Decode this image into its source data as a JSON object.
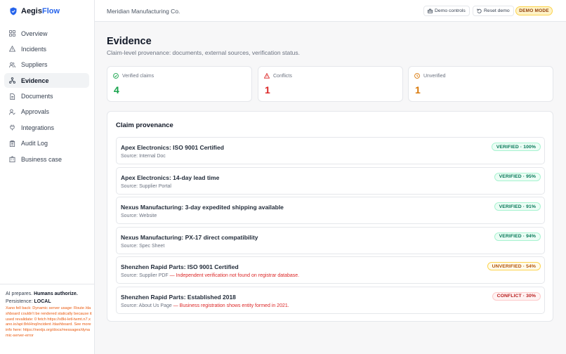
{
  "brand": {
    "name_part1": "Aegis",
    "name_part2": "Flow",
    "accent": "#2563eb"
  },
  "sidebar": {
    "items": [
      {
        "label": "Overview",
        "icon": "grid-icon",
        "active": false
      },
      {
        "label": "Incidents",
        "icon": "warning-triangle-icon",
        "active": false
      },
      {
        "label": "Suppliers",
        "icon": "users-icon",
        "active": false
      },
      {
        "label": "Evidence",
        "icon": "network-icon",
        "active": true
      },
      {
        "label": "Documents",
        "icon": "document-icon",
        "active": false
      },
      {
        "label": "Approvals",
        "icon": "user-check-icon",
        "active": false
      },
      {
        "label": "Integrations",
        "icon": "plug-icon",
        "active": false
      },
      {
        "label": "Audit Log",
        "icon": "clipboard-icon",
        "active": false
      },
      {
        "label": "Business case",
        "icon": "building-icon",
        "active": false
      }
    ],
    "footer": {
      "tagline_prefix": "AI prepares.",
      "tagline_bold": "Humans authorize.",
      "persistence_label": "Persistence:",
      "persistence_value": "LOCAL",
      "error_text": "Xano fell back: Dynamic server usage: Route /dashboard couldn't be rendered statically because it used revalidate: 0 fetch https://x8ki-letl-twmt.n7.xano.io/api:8rkHnq/incident /dashboard. See more info here: https://nextjs.org/docs/messages/dynamic-server-error"
    }
  },
  "topbar": {
    "org_name": "Meridian Manufacturing Co.",
    "demo_controls_label": "Demo controls",
    "reset_demo_label": "Reset demo",
    "demo_mode_badge": "DEMO MODE"
  },
  "page": {
    "title": "Evidence",
    "subtitle": "Claim-level provenance: documents, external sources, verification status."
  },
  "stats": [
    {
      "label": "Verified claims",
      "value": "4",
      "color": "#16a34a",
      "icon": "check-circle-icon"
    },
    {
      "label": "Conflicts",
      "value": "1",
      "color": "#dc2626",
      "icon": "warning-triangle-icon"
    },
    {
      "label": "Unverified",
      "value": "1",
      "color": "#d97706",
      "icon": "clock-icon"
    }
  ],
  "provenance": {
    "title": "Claim provenance",
    "claims": [
      {
        "title": "Apex Electronics: ISO 9001 Certified",
        "source": "Source: Internal Doc",
        "note": "",
        "status": "verified",
        "badge": "VERIFIED · 100%"
      },
      {
        "title": "Apex Electronics: 14-day lead time",
        "source": "Source: Supplier Portal",
        "note": "",
        "status": "verified",
        "badge": "VERIFIED · 95%"
      },
      {
        "title": "Nexus Manufacturing: 3-day expedited shipping available",
        "source": "Source: Website",
        "note": "",
        "status": "verified",
        "badge": "VERIFIED · 91%"
      },
      {
        "title": "Nexus Manufacturing: PX-17 direct compatibility",
        "source": "Source: Spec Sheet",
        "note": "",
        "status": "verified",
        "badge": "VERIFIED · 94%"
      },
      {
        "title": "Shenzhen Rapid Parts: ISO 9001 Certified",
        "source": "Source: Supplier PDF",
        "note": "— Independent verification not found on registrar database.",
        "status": "unverified",
        "badge": "UNVERIFIED · 54%"
      },
      {
        "title": "Shenzhen Rapid Parts: Established 2018",
        "source": "Source: About Us Page",
        "note": "— Business registration shows entity formed in 2021.",
        "status": "conflict",
        "badge": "CONFLICT · 30%"
      }
    ]
  }
}
